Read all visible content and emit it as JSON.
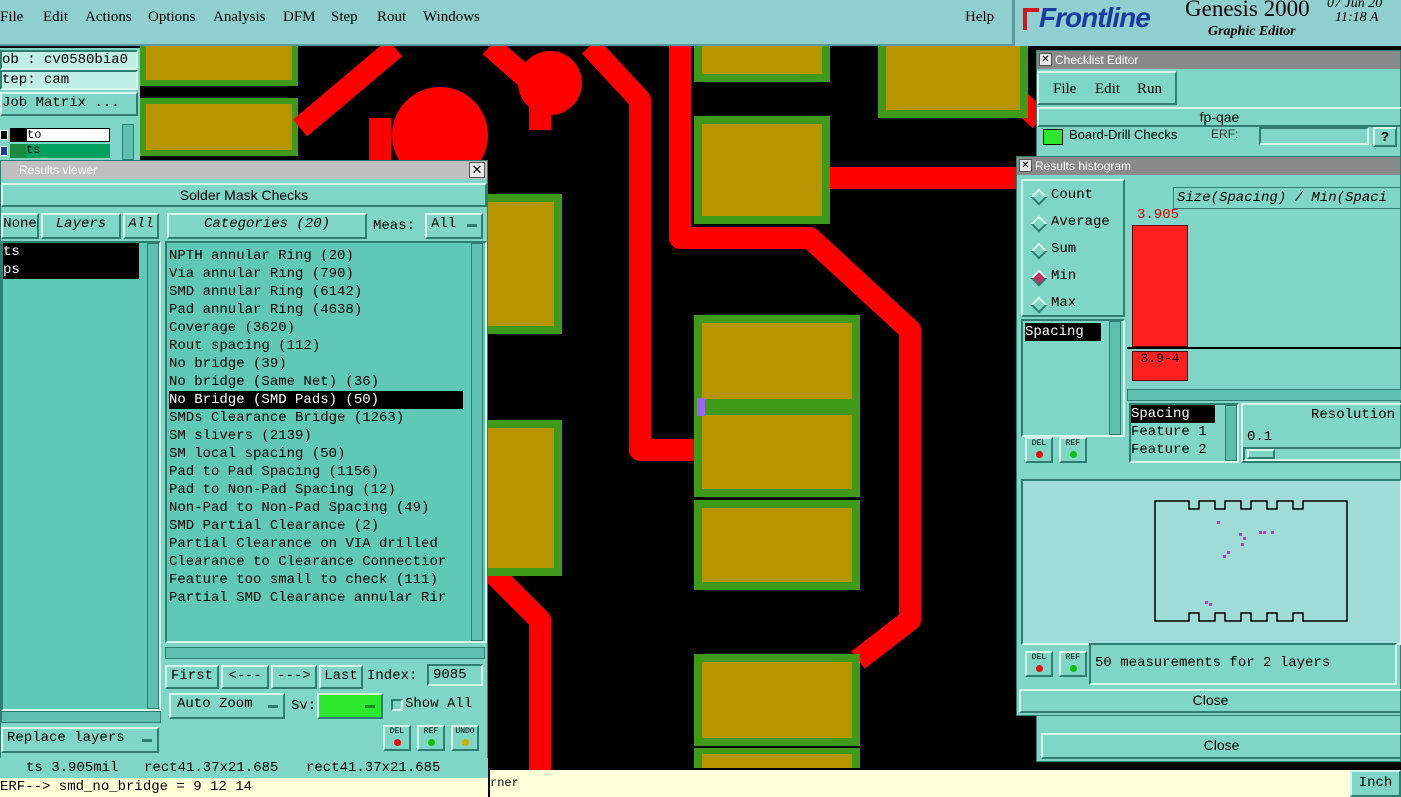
{
  "menubar": {
    "items": [
      "File",
      "Edit",
      "Actions",
      "Options",
      "Analysis",
      "DFM",
      "Step",
      "Rout",
      "Windows"
    ],
    "help": "Help"
  },
  "brand": {
    "logo": "Frontline",
    "product": "Genesis 2000",
    "subtitle": "Graphic Editor",
    "date": "07 Jun 20",
    "time": "11:18 A"
  },
  "job_panel": {
    "job": "ob : cv0580bia0",
    "step": "tep: cam",
    "job_matrix": "Job Matrix ...",
    "layer1": "to",
    "layer2": "ts"
  },
  "results_viewer": {
    "title": "Results viewer",
    "header": "Solder Mask Checks",
    "none_btn": "None",
    "layers_btn": "Layers",
    "all_btn": "All",
    "categories_btn": "Categories (20)",
    "meas_label": "Meas:",
    "meas_value": "All",
    "layers": [
      "ts",
      "ps"
    ],
    "categories": [
      "NPTH annular Ring (20)",
      "Via annular Ring (790)",
      "SMD annular Ring (6142)",
      "Pad annular Ring (4638)",
      "Coverage (3620)",
      "Rout spacing (112)",
      "No bridge (39)",
      "No bridge (Same Net) (36)",
      "No Bridge (SMD Pads) (50)",
      "SMDs Clearance Bridge (1263)",
      "SM slivers (2139)",
      "SM local spacing (50)",
      "Pad to Pad Spacing (1156)",
      "Pad to Non-Pad Spacing (12)",
      "Non-Pad to Non-Pad Spacing (49)",
      "SMD Partial Clearance (2)",
      "Partial Clearance on VIA drilled",
      "Clearance to Clearance Connectior",
      "Feature too small to check (111)",
      "Partial SMD Clearance annular Rir"
    ],
    "selected_index": 8,
    "first_btn": "First",
    "prev_btn": "<---",
    "next_btn": "--->",
    "last_btn": "Last",
    "index_label": "Index:",
    "index_value": "9085",
    "auto_zoom": "Auto Zoom",
    "sv_label": "Sv:",
    "show_all": "Show All",
    "replace_layers": "Replace layers",
    "del": "DEL",
    "ref": "REF",
    "undo": "UNDO"
  },
  "status": {
    "line1_a": "ts 3.905mil",
    "line1_b": "rect41.37x21.685",
    "line1_c": "rect41.37x21.685",
    "line2": "ERF--> smd_no_bridge = 9 12 14",
    "bottom_mid": "rner",
    "units": "Inch"
  },
  "checklist_editor": {
    "title": "Checklist Editor",
    "menu": [
      "File",
      "Edit",
      "Run"
    ],
    "name": "fp-qae",
    "row_label": "Board-Drill Checks",
    "erf": "ERF:",
    "help": "?",
    "close": "Close"
  },
  "histogram": {
    "title": "Results histogram",
    "modes": [
      "Count",
      "Average",
      "Sum",
      "Min",
      "Max"
    ],
    "selected_mode": "Min",
    "chart_title": "Size(Spacing) / Min(Spaci",
    "bar_value": "3.905",
    "bar_range": "3.9-4",
    "list_items": [
      "Spacing"
    ],
    "fields": [
      "Spacing",
      "Feature 1",
      "Feature 2"
    ],
    "resolution_label": "Resolution",
    "resolution_value": "0.1",
    "del": "DEL",
    "ref": "REF",
    "summary": "50 measurements for 2 layers",
    "close": "Close"
  },
  "colors": {
    "panel": "#7fd6c6",
    "menubar": "#8fcfcf",
    "trace": "#ff0000",
    "pad_fill": "#b89400",
    "pad_edge": "#3f9a1a",
    "marker": "#cc33cc"
  }
}
